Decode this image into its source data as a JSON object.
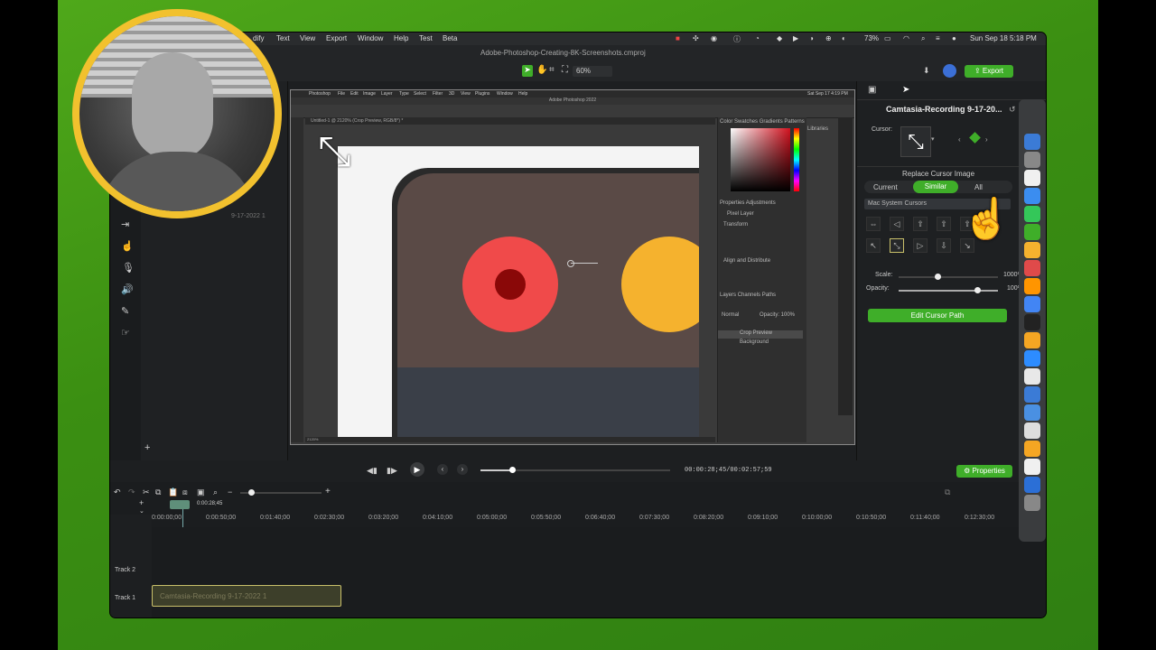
{
  "menubar": {
    "items": [
      "dify",
      "Text",
      "View",
      "Export",
      "Window",
      "Help",
      "Test",
      "Beta"
    ],
    "status": {
      "battery": "73%",
      "datetime": "Sun Sep 18  5:18 PM"
    }
  },
  "titlebar": {
    "title": "Adobe-Photoshop-Creating-8K-Screenshots.cmproj"
  },
  "toolbar": {
    "zoom": "60%",
    "export_label": "Export"
  },
  "leftpanel": {
    "media_label": "9-17-2022 1"
  },
  "photoshop": {
    "app": "Photoshop",
    "menus": [
      "File",
      "Edit",
      "Image",
      "Layer",
      "Type",
      "Select",
      "Filter",
      "3D",
      "View",
      "Plugins",
      "Window",
      "Help"
    ],
    "window_title": "Adobe Photoshop 2022",
    "date": "Sat Sep 17  4:19 PM",
    "tab": "Untitled-1 @ 2120% (Crop Preview, RGB/8*) *",
    "status_zoom": "2120%",
    "panels": {
      "color_tabs": [
        "Color",
        "Swatches",
        "Gradients",
        "Patterns"
      ],
      "libraries": "Libraries",
      "properties_tabs": [
        "Properties",
        "Adjustments"
      ],
      "pixel_layer": "Pixel Layer",
      "transform": "Transform",
      "align": "Align and Distribute",
      "layers_tabs": [
        "Layers",
        "Channels",
        "Paths"
      ],
      "blend_mode": "Normal",
      "opacity": "Opacity: 100%",
      "layers": [
        "Crop Preview",
        "Background"
      ]
    }
  },
  "properties": {
    "title": "Camtasia-Recording 9-17-20...",
    "cursor_label": "Cursor:",
    "replace_heading": "Replace Cursor Image",
    "scope_options": [
      "Current",
      "Similar",
      "All"
    ],
    "scope_selected": "Similar",
    "cursor_set": "Mac System Cursors",
    "scale_label": "Scale:",
    "scale_value": "1000%",
    "opacity_label": "Opacity:",
    "opacity_value": "100%",
    "edit_path_label": "Edit Cursor Path"
  },
  "playback": {
    "time_current": "00:00:28;45",
    "time_total": "00:02:57;59",
    "properties_label": "Properties"
  },
  "timeline": {
    "playhead_time": "0:00:28;45",
    "ruler": [
      "0:00:00;00",
      "0:00:50;00",
      "0:01:40;00",
      "0:02:30;00",
      "0:03:20;00",
      "0:04:10;00",
      "0:05:00;00",
      "0:05:50;00",
      "0:06:40;00",
      "0:07:30;00",
      "0:08:20;00",
      "0:09:10;00",
      "0:10:00;00",
      "0:10:50;00",
      "0:11:40;00",
      "0:12:30;00"
    ],
    "tracks": [
      "Track 2",
      "Track 1"
    ],
    "clip_label": "Camtasia-Recording 9-17-2022 1"
  },
  "colors": {
    "accent": "#3fae29",
    "webcam_ring": "#f2c12e",
    "red_dot": "#f04a4a",
    "yellow_dot": "#f5b22e"
  }
}
